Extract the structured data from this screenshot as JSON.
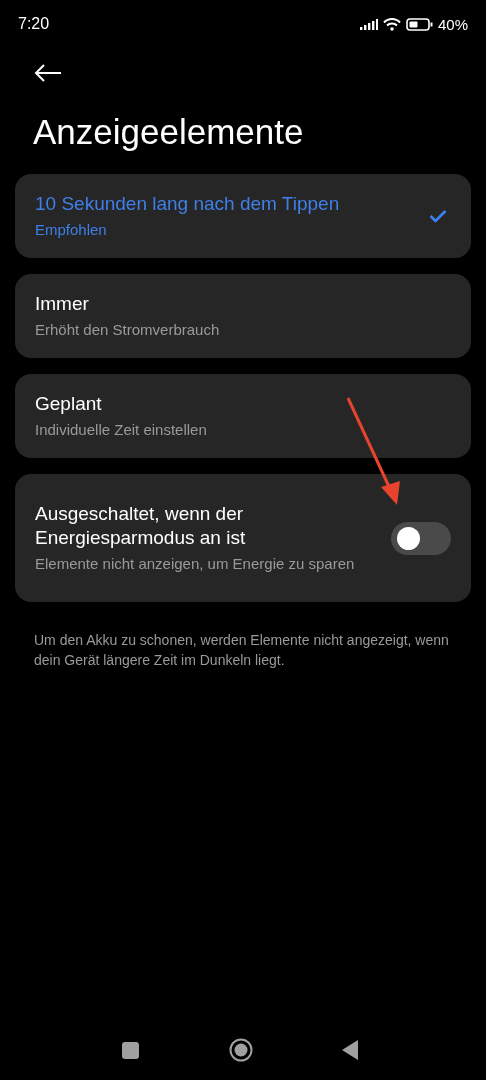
{
  "status_bar": {
    "time": "7:20",
    "battery": "40%"
  },
  "page": {
    "title": "Anzeigeelemente"
  },
  "options": [
    {
      "kind": "choice",
      "title": "10 Sekunden lang nach dem Tippen",
      "subtitle": "Empfohlen",
      "selected": true
    },
    {
      "kind": "choice",
      "title": "Immer",
      "subtitle": "Erhöht den Stromverbrauch",
      "selected": false
    },
    {
      "kind": "choice",
      "title": "Geplant",
      "subtitle": "Individuelle Zeit einstellen",
      "selected": false
    },
    {
      "kind": "toggle",
      "title": "Ausgeschaltet, wenn der Energiesparmodus an ist",
      "subtitle": "Elemente nicht anzeigen, um Energie zu sparen",
      "on": false
    }
  ],
  "note": "Um den Akku zu schonen, werden Elemente nicht angezeigt, wenn dein Gerät längere Zeit im Dunkeln liegt."
}
